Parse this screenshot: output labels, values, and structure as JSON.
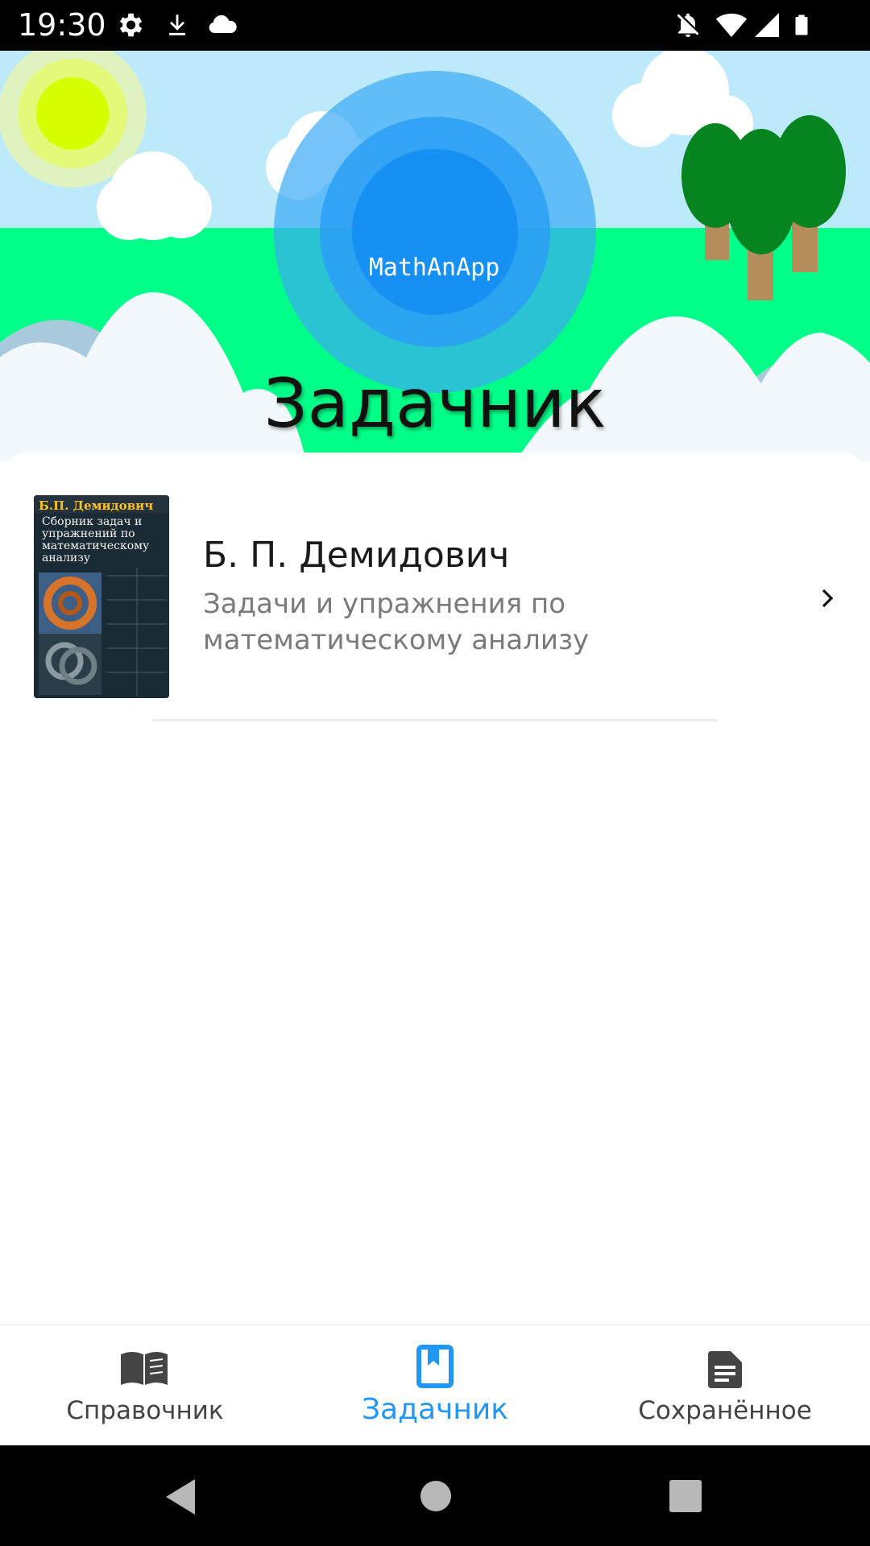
{
  "status_bar": {
    "time": "19:30",
    "left_icons": [
      "gear-icon",
      "download-icon",
      "cloud-icon"
    ],
    "right_icons": [
      "notifications-off-icon",
      "wifi-icon",
      "cellular-signal-icon",
      "battery-icon"
    ]
  },
  "header": {
    "logo_text": "MathAnApp",
    "title": "Задачник"
  },
  "books": [
    {
      "author": "Б. П. Демидович",
      "title": "Задачи и упражнения по математическому анализу",
      "cover": {
        "author": "Б.П. Демидович",
        "title": "Сборник задач и упражнений по математическому анализу"
      }
    }
  ],
  "bottom_nav": {
    "items": [
      {
        "label": "Справочник",
        "icon": "book-open-icon",
        "active": false
      },
      {
        "label": "Задачник",
        "icon": "bookmark-book-icon",
        "active": true
      },
      {
        "label": "Сохранённое",
        "icon": "document-icon",
        "active": false
      }
    ]
  },
  "colors": {
    "accent": "#2196f3",
    "sky": "#bdeafa",
    "grass": "#00ff88",
    "status_bar": "#000000"
  }
}
